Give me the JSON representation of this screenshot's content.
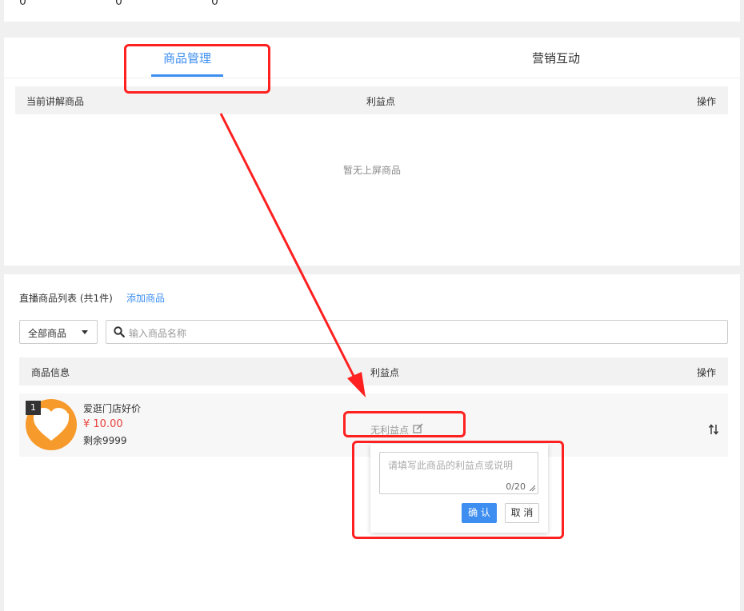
{
  "stats": [
    "0",
    "0",
    "0"
  ],
  "tabs": [
    {
      "label": "商品管理",
      "active": true
    },
    {
      "label": "营销互动",
      "active": false
    }
  ],
  "current_table": {
    "headers": [
      "当前讲解商品",
      "利益点",
      "操作"
    ],
    "empty_text": "暂无上屏商品"
  },
  "list": {
    "title": "直播商品列表 (共1件)",
    "add_link": "添加商品",
    "filter_value": "全部商品",
    "search_placeholder": "输入商品名称",
    "headers": [
      "商品信息",
      "利益点",
      "操作"
    ],
    "rows": [
      {
        "index": "1",
        "name": "爱逛门店好价",
        "price": "¥ 10.00",
        "stock": "剩余9999",
        "benefit": "无利益点"
      }
    ]
  },
  "popover": {
    "placeholder": "请填写此商品的利益点或说明",
    "counter": "0/20",
    "confirm": "确 认",
    "cancel": "取 消"
  },
  "colors": {
    "accent": "#3d8ef0",
    "price": "#e8413b",
    "highlight": "#ff2020",
    "thumb": "#f79a2c"
  },
  "icons": [
    "search-icon",
    "caret-down-icon",
    "edit-icon",
    "sort-icon",
    "heart-icon",
    "thumbs-up-icon"
  ]
}
